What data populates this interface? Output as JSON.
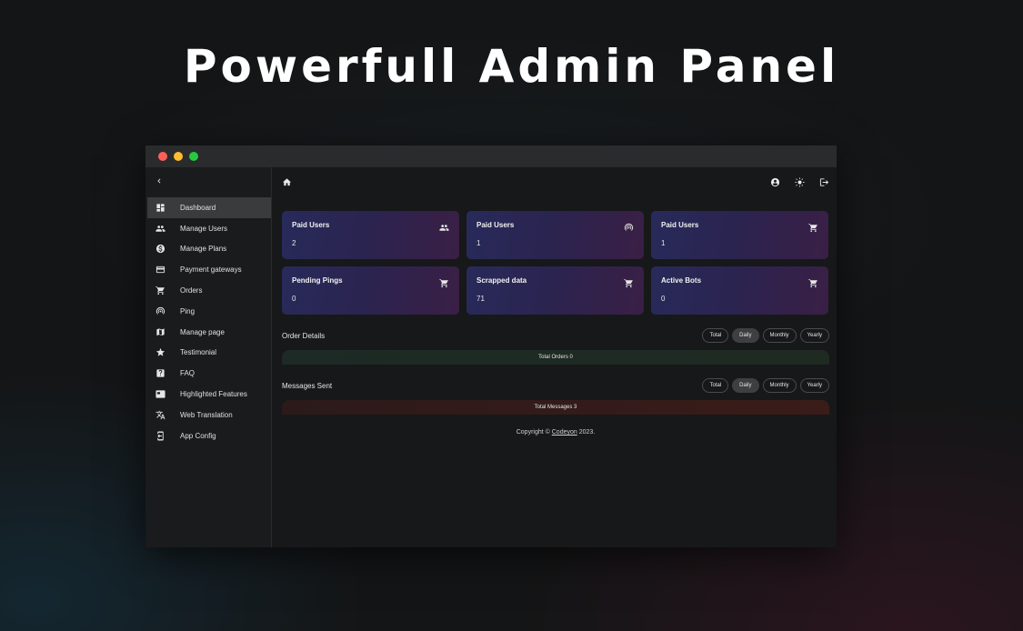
{
  "hero": {
    "title": "Powerfull Admin Panel"
  },
  "window": {
    "controls": [
      {
        "name": "close",
        "color": "#ff5f57"
      },
      {
        "name": "minimize",
        "color": "#febc2e"
      },
      {
        "name": "maximize",
        "color": "#28c840"
      }
    ]
  },
  "sidebar": {
    "collapse_icon": "chevron-left-icon",
    "items": [
      {
        "label": "Dashboard",
        "icon": "dashboard-icon",
        "active": true
      },
      {
        "label": "Manage Users",
        "icon": "people-icon"
      },
      {
        "label": "Manage Plans",
        "icon": "dollar-icon"
      },
      {
        "label": "Payment gateways",
        "icon": "credit-card-icon"
      },
      {
        "label": "Orders",
        "icon": "cart-icon"
      },
      {
        "label": "Ping",
        "icon": "ping-icon"
      },
      {
        "label": "Manage page",
        "icon": "map-icon"
      },
      {
        "label": "Testimonial",
        "icon": "star-icon"
      },
      {
        "label": "FAQ",
        "icon": "question-icon"
      },
      {
        "label": "Highlighted Features",
        "icon": "feature-icon"
      },
      {
        "label": "Web Translation",
        "icon": "translate-icon"
      },
      {
        "label": "App Config",
        "icon": "app-config-icon"
      }
    ]
  },
  "topbar": {
    "left_icon": "home-icon",
    "right_icons": [
      "account-icon",
      "theme-icon",
      "logout-icon"
    ]
  },
  "cards": [
    {
      "title": "Paid Users",
      "value": "2",
      "icon": "people-icon"
    },
    {
      "title": "Paid Users",
      "value": "1",
      "icon": "ping-icon"
    },
    {
      "title": "Paid Users",
      "value": "1",
      "icon": "cart-icon"
    },
    {
      "title": "Pending Pings",
      "value": "0",
      "icon": "cart-icon"
    },
    {
      "title": "Scrapped data",
      "value": "71",
      "icon": "cart-icon"
    },
    {
      "title": "Active Bots",
      "value": "0",
      "icon": "cart-icon"
    }
  ],
  "orders": {
    "title": "Order Details",
    "filters": [
      "Total",
      "Daily",
      "Monthly",
      "Yearly"
    ],
    "active_filter": "Daily",
    "bar_label": "Total Orders 0"
  },
  "messages": {
    "title": "Messages Sent",
    "filters": [
      "Total",
      "Daily",
      "Monthly",
      "Yearly"
    ],
    "active_filter": "Daily",
    "bar_label": "Total Messages 3"
  },
  "footer": {
    "prefix": "Copyright © ",
    "link": "Codeyon",
    "suffix": " 2023."
  }
}
